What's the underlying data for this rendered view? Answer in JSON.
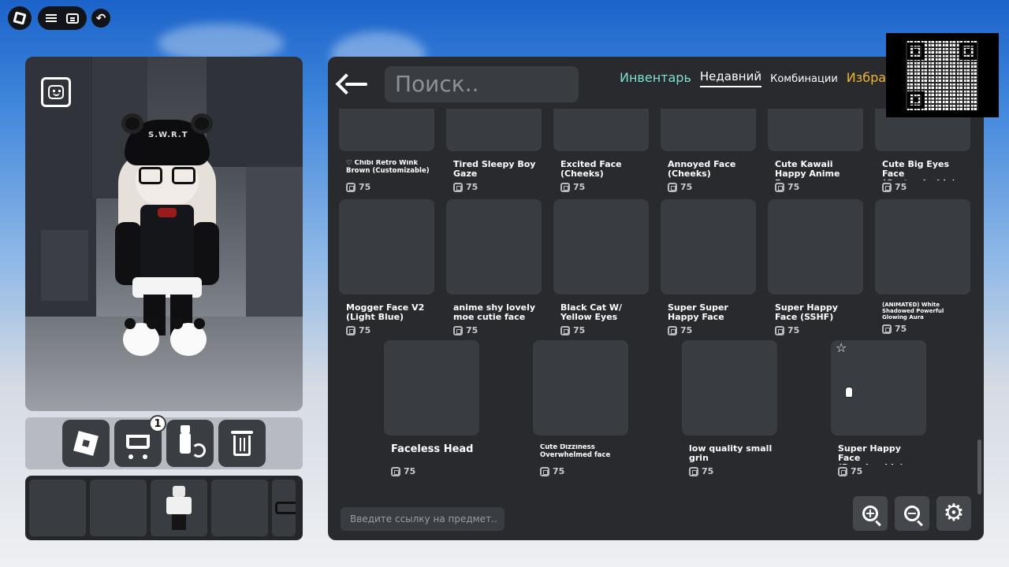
{
  "search": {
    "placeholder": "Поиск.."
  },
  "tabs": [
    {
      "label": "Инвентарь",
      "color": "#7fe0d3"
    },
    {
      "label": "Недавний",
      "active": true
    },
    {
      "label": "Комбинации"
    },
    {
      "label": "Избран",
      "color": "#f2b632"
    }
  ],
  "items": [
    {
      "name": "♡ Chibi Retro Wink Brown (Customizable)",
      "price": "75"
    },
    {
      "name": "Tired Sleepy Boy Gaze",
      "price": "75"
    },
    {
      "name": "Excited Face (Cheeks)",
      "price": "75"
    },
    {
      "name": "Annoyed Face (Cheeks)",
      "price": "75"
    },
    {
      "name": "Cute Kawaii Happy Anime Face",
      "price": "75"
    },
    {
      "name": "Cute Big Eyes Face (Customizable)",
      "price": "75"
    },
    {
      "name": "Mogger Face V2 (Light Blue)",
      "price": "75"
    },
    {
      "name": "anime shy lovely moe cutie face",
      "price": "75"
    },
    {
      "name": "Black Cat W/ Yellow Eyes",
      "price": "75"
    },
    {
      "name": "Super Super Happy Face",
      "price": "75"
    },
    {
      "name": "Super Happy Face (SSHF)",
      "price": "75"
    },
    {
      "name": "(ANIMATED) White Shadowed Powerful Glowing Aura",
      "price": "75"
    },
    {
      "name": "Faceless Head",
      "price": "75"
    },
    {
      "name": "Cute Dizziness Overwhelmed face",
      "price": "75"
    },
    {
      "name": "low quality small grin",
      "price": "75"
    },
    {
      "name": "Super Happy Face (Recolorable)",
      "price": "75"
    }
  ],
  "url_input": {
    "placeholder": "Введите ссылку на предмет.."
  },
  "cart": {
    "count": "1"
  },
  "avatar": {
    "hat_text": "S.W.R.T"
  },
  "icons": {
    "roblox": "roblox-logo-icon",
    "menu": "hamburger-icon",
    "chat": "chat-icon",
    "undo": "undo-icon",
    "face_scan": "face-scan-icon",
    "cart": "cart-icon",
    "swap": "swap-avatar-icon",
    "trash": "trash-icon",
    "zoom_in": "zoom-in-icon",
    "zoom_out": "zoom-out-icon",
    "settings": "gear-icon",
    "robux": "robux-icon"
  }
}
